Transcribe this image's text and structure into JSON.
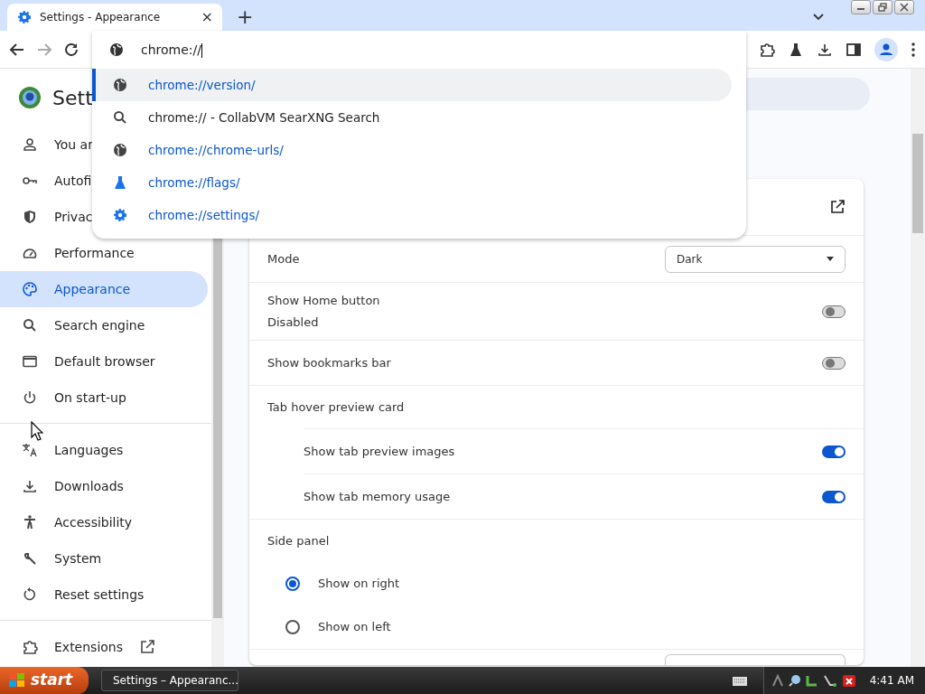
{
  "tab": {
    "title": "Settings - Appearance",
    "close": "×",
    "new_tab": "+"
  },
  "omnibox": {
    "value": "chrome://"
  },
  "suggestions": [
    {
      "kind": "globe",
      "text": "chrome://version/",
      "url": true,
      "selected": true
    },
    {
      "kind": "search",
      "text": "chrome:// - CollabVM SearXNG Search",
      "url": false,
      "selected": false
    },
    {
      "kind": "globe",
      "text": "chrome://chrome-urls/",
      "url": true,
      "selected": false
    },
    {
      "kind": "flask",
      "text": "chrome://flags/",
      "url": true,
      "selected": false
    },
    {
      "kind": "gear",
      "text": "chrome://settings/",
      "url": true,
      "selected": false
    }
  ],
  "sidebar": {
    "title": "Sett",
    "groups": [
      [
        {
          "kind": "person",
          "label": "You ar",
          "selected": false
        },
        {
          "kind": "key",
          "label": "Autofi",
          "selected": false
        },
        {
          "kind": "shield",
          "label": "Privac",
          "selected": false
        },
        {
          "kind": "gauge",
          "label": "Performance",
          "selected": false
        },
        {
          "kind": "palette",
          "label": "Appearance",
          "selected": true
        },
        {
          "kind": "search",
          "label": "Search engine",
          "selected": false
        },
        {
          "kind": "window",
          "label": "Default browser",
          "selected": false
        },
        {
          "kind": "power",
          "label": "On start-up",
          "selected": false
        }
      ],
      [
        {
          "kind": "translate",
          "label": "Languages",
          "selected": false
        },
        {
          "kind": "download",
          "label": "Downloads",
          "selected": false
        },
        {
          "kind": "accessibility",
          "label": "Accessibility",
          "selected": false
        },
        {
          "kind": "wrench",
          "label": "System",
          "selected": false
        },
        {
          "kind": "reset",
          "label": "Reset settings",
          "selected": false
        }
      ],
      [
        {
          "kind": "puzzle",
          "label": "Extensions",
          "selected": false,
          "external": true
        }
      ]
    ]
  },
  "settings": [
    {
      "kind": "header"
    },
    {
      "kind": "select",
      "label": "Mode",
      "value": "Dark"
    },
    {
      "kind": "toggle",
      "label": "Show Home button",
      "sublabel": "Disabled",
      "on": false
    },
    {
      "kind": "toggle",
      "label": "Show bookmarks bar",
      "on": false
    },
    {
      "kind": "heading",
      "label": "Tab hover preview card"
    },
    {
      "kind": "subtoggle",
      "label": "Show tab preview images",
      "on": true
    },
    {
      "kind": "subtoggle",
      "label": "Show tab memory usage",
      "on": true
    },
    {
      "kind": "heading",
      "label": "Side panel"
    },
    {
      "kind": "radio",
      "label": "Show on right",
      "selected": true
    },
    {
      "kind": "radio",
      "label": "Show on left",
      "selected": false
    },
    {
      "kind": "cut"
    }
  ],
  "taskbar": {
    "start": "start",
    "window": "Settings – Appearanc...",
    "clock": "4:41 AM"
  }
}
